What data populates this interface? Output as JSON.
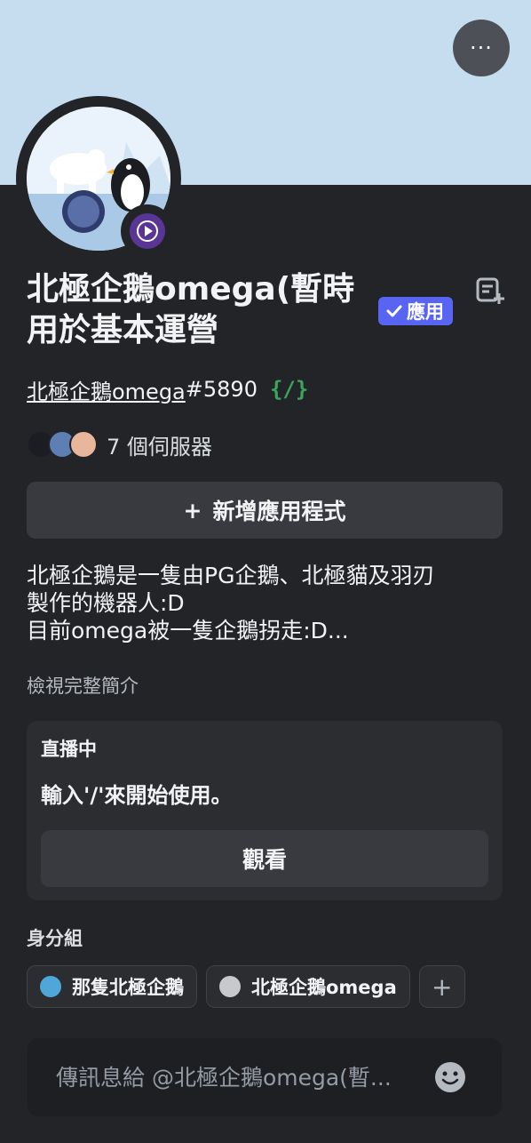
{
  "header": {
    "more_label": "···",
    "banner_color": "#c6ddf0"
  },
  "profile": {
    "display_name": "北極企鵝omega(暫時用於基本運營",
    "app_badge": "應用",
    "username": "北極企鵝omega",
    "discriminator": "#5890",
    "command_icon": "{/}",
    "mutual_servers_label": "7 個伺服器",
    "status": "streaming",
    "status_color": "#593695"
  },
  "actions": {
    "add_app_plus": "+",
    "add_app_label": "新增應用程式"
  },
  "bio": {
    "lines": [
      "北極企鵝是一隻由PG企鵝、北極貓及羽刃",
      "製作的機器人:D",
      "目前omega被一隻企鵝拐走:D..."
    ],
    "view_full_label": "檢視完整簡介"
  },
  "activity": {
    "title": "直播中",
    "description": "輸入'/'來開始使用。",
    "watch_label": "觀看"
  },
  "roles": {
    "title": "身分組",
    "items": [
      {
        "name": "那隻北極企鵝",
        "color": "#4fa6d8"
      },
      {
        "name": "北極企鵝omega",
        "color": "#c7c9cc"
      }
    ],
    "add_label": "+"
  },
  "message": {
    "placeholder": "傳訊息給 @北極企鵝omega(暫..."
  }
}
